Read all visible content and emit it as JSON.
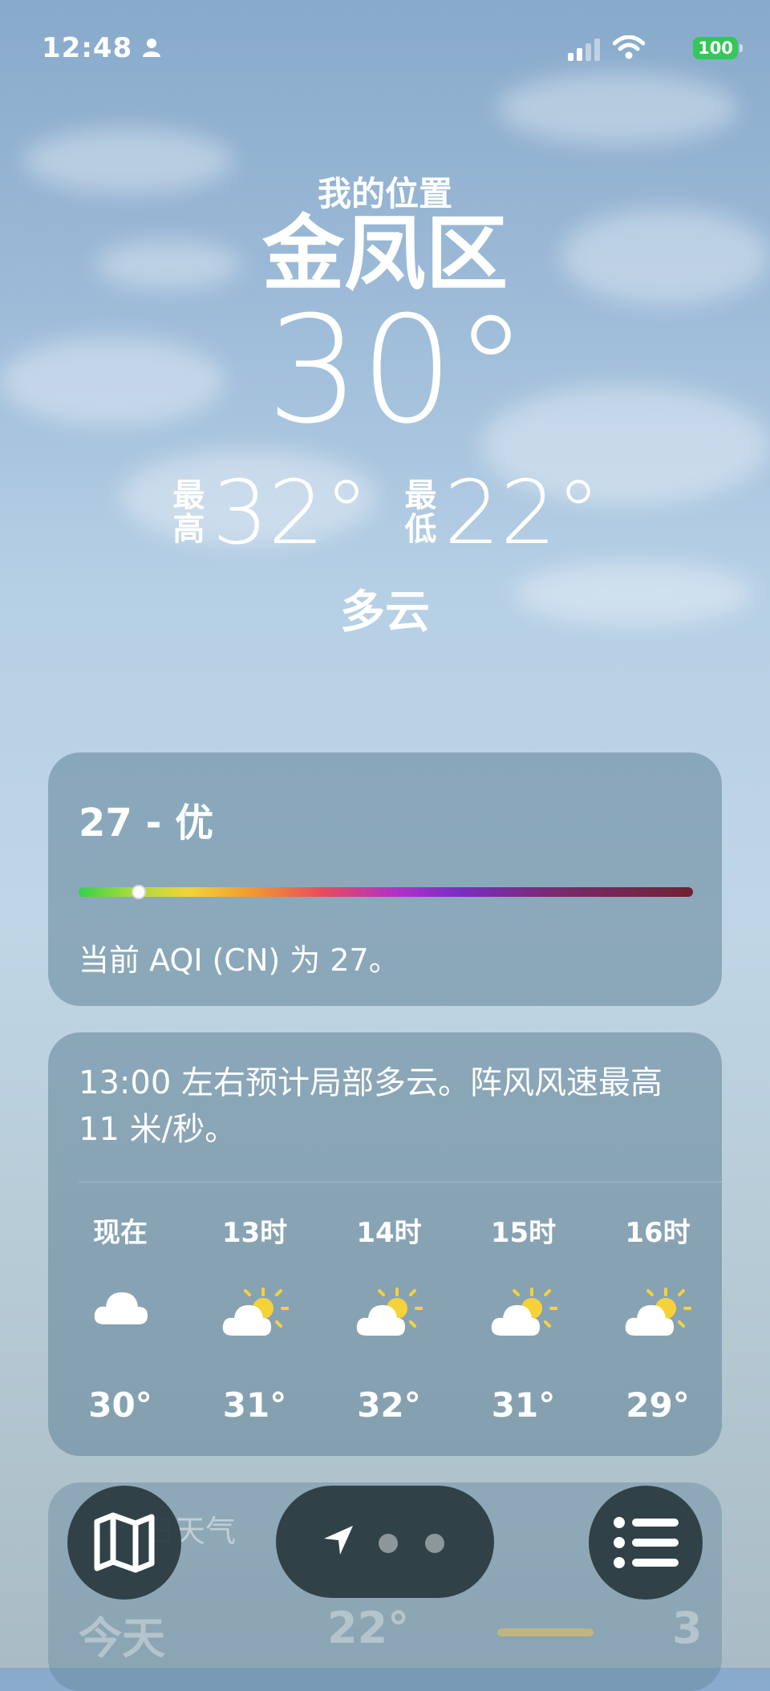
{
  "status_bar": {
    "time": "12:48",
    "battery": "100"
  },
  "header": {
    "location_label": "我的位置",
    "city": "金凤区",
    "temperature": "30°",
    "high_label": "最高",
    "high": "32°",
    "low_label": "最低",
    "low": "22°",
    "condition": "多云"
  },
  "aqi": {
    "title": "27 - 优",
    "value": 27,
    "description": "当前 AQI (CN) 为 27。"
  },
  "hourly": {
    "summary": "13:00 左右预计局部多云。阵风风速最高 11 米/秒。",
    "hours": [
      {
        "label": "现在",
        "icon": "cloud-icon",
        "temp": "30°"
      },
      {
        "label": "13时",
        "icon": "partly-sunny-icon",
        "temp": "31°"
      },
      {
        "label": "14时",
        "icon": "partly-sunny-icon",
        "temp": "32°"
      },
      {
        "label": "15时",
        "icon": "partly-sunny-icon",
        "temp": "31°"
      },
      {
        "label": "16时",
        "icon": "partly-sunny-icon",
        "temp": "29°"
      }
    ]
  },
  "ten_day": {
    "title_partial": "日天气",
    "today_label": "今天",
    "today_low": "22°",
    "today_high_partial": "3"
  },
  "toolbar": {
    "map_icon": "map-icon",
    "location_icon": "location-arrow-icon",
    "list_icon": "list-icon",
    "page_count": 3
  },
  "colors": {
    "battery": "#34c759",
    "aqi_indicator": "#ffffff",
    "sun": "#f6d23a"
  }
}
